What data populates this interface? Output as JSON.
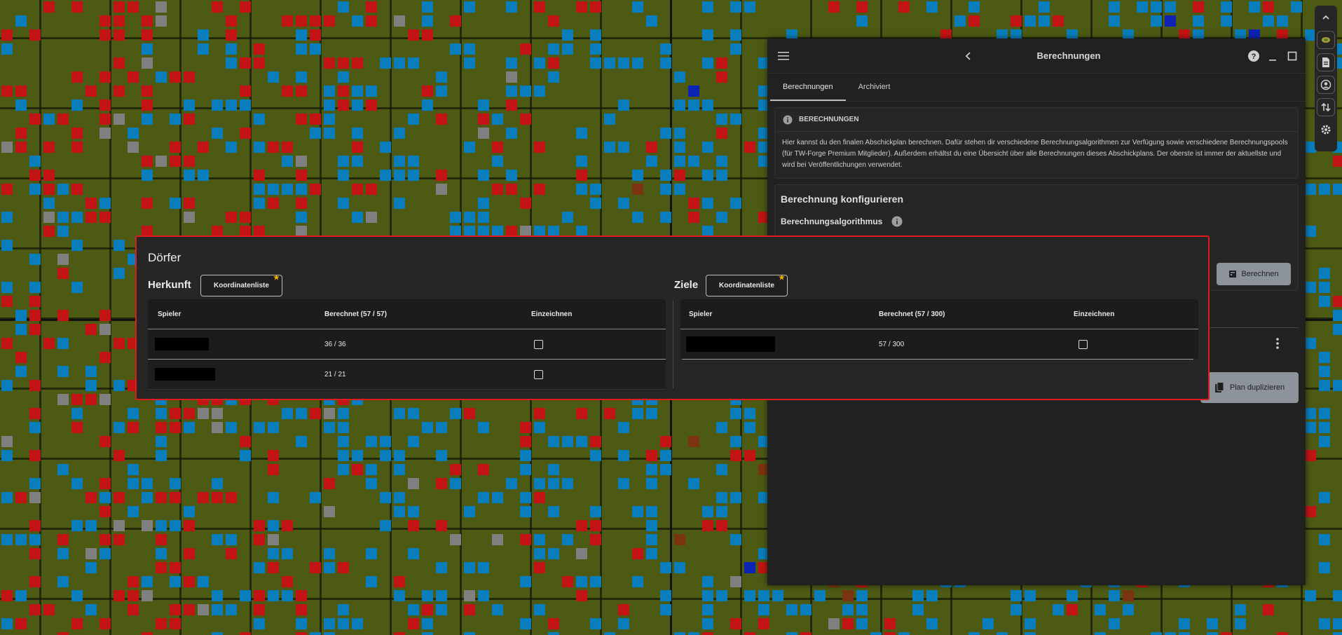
{
  "colors": {
    "map_background": "#4d5a14",
    "village_blue": "#0a7dbd",
    "village_red": "#c21414",
    "village_darkblue": "#0e22b3",
    "village_brown": "#7a3410",
    "village_gray": "#808080",
    "highlight_border": "#e01b1b",
    "panel_bg": "#212121",
    "star": "#f0b400"
  },
  "panel": {
    "title": "Berechnungen",
    "tabs": [
      {
        "label": "Berechnungen",
        "active": true
      },
      {
        "label": "Archiviert",
        "active": false
      }
    ],
    "info": {
      "heading": "BERECHNUNGEN",
      "text": "Hier kannst du den finalen Abschickplan berechnen. Dafür stehen dir verschiedene Berechnungsalgorithmen zur Verfügung sowie verschiedene Berechnungspools (für TW-Forge Premium Mitglieder). Außerdem erhältst du eine Übersicht über alle Berechnungen dieses Abschickplans. Der oberste ist immer der aktuellste und wird bei Veröffentlichungen verwendet."
    },
    "config": {
      "title": "Berechnung konfigurieren",
      "algorithm_label": "Berechnungsalgorithmus",
      "calc_button": "Berechnen"
    },
    "duplicate_button": "Plan duplizieren"
  },
  "rail": {
    "icons": [
      "chevron-up-icon",
      "map-icon",
      "document-icon",
      "account-icon",
      "sort-icon",
      "gear-icon"
    ]
  },
  "doerfer": {
    "title": "Dörfer",
    "herkunft": {
      "label": "Herkunft",
      "button": "Koordinatenliste",
      "columns": {
        "spieler": "Spieler",
        "berechnet": "Berechnet (57 / 57)",
        "einzeichnen": "Einzeichnen"
      },
      "rows": [
        {
          "berechnet": "36 / 36"
        },
        {
          "berechnet": "21 / 21"
        }
      ]
    },
    "ziele": {
      "label": "Ziele",
      "button": "Koordinatenliste",
      "columns": {
        "spieler": "Spieler",
        "berechnet": "Berechnet (57 / 300)",
        "einzeichnen": "Einzeichnen"
      },
      "rows": [
        {
          "berechnet": "57 / 300"
        }
      ]
    }
  }
}
